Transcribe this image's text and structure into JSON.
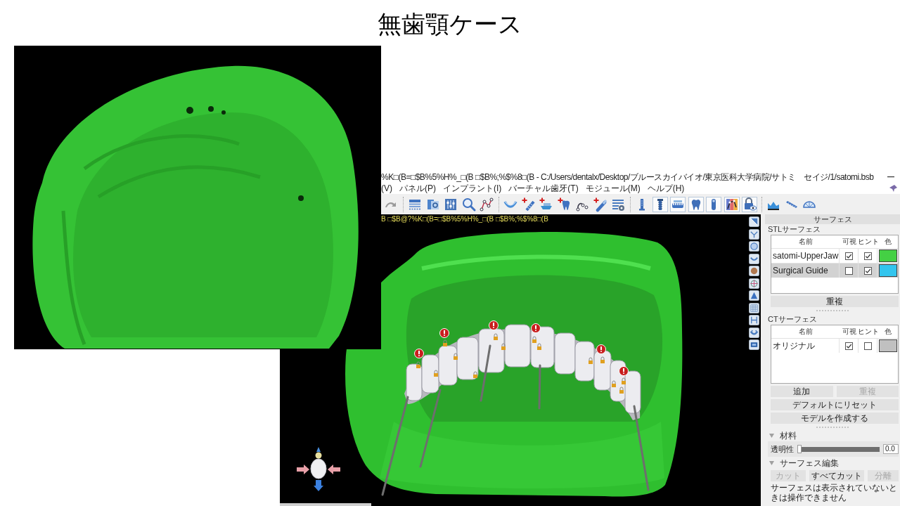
{
  "slide": {
    "title": "無歯顎ケース"
  },
  "window": {
    "title": "%K□(B=□$B%5%H%_□(B □$B%;%$%8□(B - C:/Users/dentalx/Desktop/ブルースカイバイオ/東京医科大学病院/サトミ　セイジ/1/satomi.bsb"
  },
  "menu": [
    "(V)",
    "パネル(P)",
    "インプラント(I)",
    "バーチャル歯牙(T)",
    "モジュール(M)",
    "ヘルプ(H)"
  ],
  "toolbar_groups": [
    [
      {
        "selected": false
      }
    ],
    [
      {
        "selected": false
      },
      {
        "selected": false
      },
      {
        "selected": false
      },
      {
        "selected": false
      },
      {
        "selected": false
      }
    ],
    [
      {
        "selected": false
      },
      {
        "selected": false
      },
      {
        "selected": false
      },
      {
        "selected": false
      },
      {
        "selected": false
      },
      {
        "selected": false
      },
      {
        "selected": false
      }
    ],
    [
      {
        "selected": false
      },
      {
        "selected": true
      },
      {
        "selected": true
      },
      {
        "selected": true
      },
      {
        "selected": true
      },
      {
        "selected": true
      },
      {
        "selected": true
      }
    ],
    [
      {
        "selected": false
      },
      {
        "selected": false
      },
      {
        "selected": false
      }
    ]
  ],
  "viewport": {
    "overlay_text": "B □$B@?%K□(B=□$B%5%H%_□(B □$B%;%$%8□(B"
  },
  "panel": {
    "title": "サーフェス",
    "stl_surfaces": {
      "label": "STLサーフェス",
      "columns": [
        "名前",
        "可視",
        "ヒント",
        "色"
      ],
      "rows": [
        {
          "name": "satomi-UpperJaw",
          "visible": true,
          "hint": true,
          "color": "#44d044",
          "selected": false
        },
        {
          "name": "Surgical Guide",
          "visible": false,
          "hint": true,
          "color": "#33c5ee",
          "selected": true
        }
      ],
      "buttons": [
        {
          "label": "重複",
          "disabled": false
        }
      ]
    },
    "ct_surfaces": {
      "label": "CTサーフェス",
      "columns": [
        "名前",
        "可視",
        "ヒント",
        "色"
      ],
      "rows": [
        {
          "name": "オリジナル",
          "visible": true,
          "hint": false,
          "color": "#c0c0c0",
          "selected": false
        }
      ],
      "buttons": [
        {
          "label": "追加",
          "disabled": false
        },
        {
          "label": "重複",
          "disabled": true
        }
      ],
      "actions": [
        {
          "label": "デフォルトにリセット",
          "disabled": false
        },
        {
          "label": "モデルを作成する",
          "disabled": false
        }
      ]
    },
    "material": {
      "title": "材料",
      "expanded": true,
      "transparency": {
        "label": "透明性",
        "level": 0,
        "reading": "0.0"
      }
    },
    "surface_edit": {
      "title": "サーフェス編集",
      "expanded": true,
      "buttons": [
        {
          "label": "カット",
          "disabled": true
        },
        {
          "label": "すべてカット",
          "disabled": false
        },
        {
          "label": "分離",
          "disabled": true
        }
      ],
      "note": "サーフェスは表示されていないときは操作できません"
    }
  }
}
